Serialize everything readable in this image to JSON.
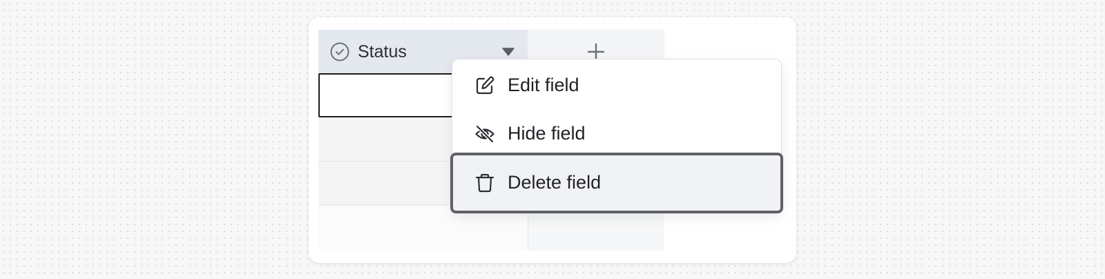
{
  "column_header": {
    "status_label": "Status",
    "status_icon": "check-circle-icon",
    "dropdown_icon": "caret-down-icon",
    "add_column_icon": "plus-icon"
  },
  "context_menu": {
    "items": [
      {
        "label": "Edit field",
        "icon": "edit-icon"
      },
      {
        "label": "Hide field",
        "icon": "eye-off-icon"
      },
      {
        "label": "Delete field",
        "icon": "trash-icon",
        "focused": true
      }
    ]
  },
  "colors": {
    "header_bg": "#e4e8ef",
    "focus_ring": "#5f6166",
    "selected_cell_border": "#1c1c1c"
  }
}
